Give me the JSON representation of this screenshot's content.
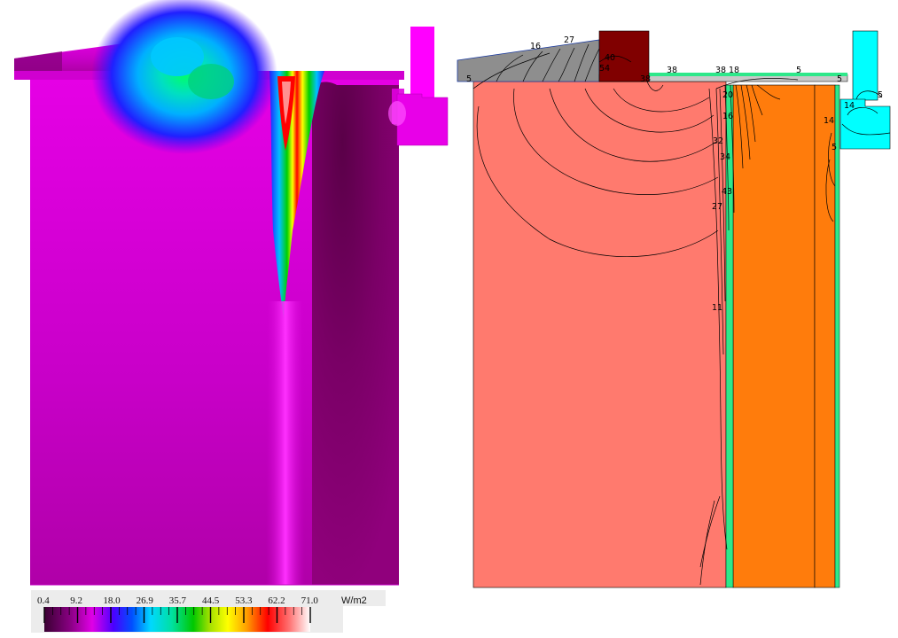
{
  "legend": {
    "tick_labels": [
      "0.4",
      "9.2",
      "18.0",
      "26.9",
      "35.7",
      "44.5",
      "53.3",
      "62.2",
      "71.0"
    ],
    "unit": "W/m2",
    "gradient_stops": [
      {
        "at": 0.0,
        "color": "#3a0032"
      },
      {
        "at": 0.1,
        "color": "#8b0085"
      },
      {
        "at": 0.18,
        "color": "#e000e6"
      },
      {
        "at": 0.26,
        "color": "#4a00ff"
      },
      {
        "at": 0.33,
        "color": "#0050ff"
      },
      {
        "at": 0.4,
        "color": "#00d8ff"
      },
      {
        "at": 0.48,
        "color": "#00e0a0"
      },
      {
        "at": 0.56,
        "color": "#00c800"
      },
      {
        "at": 0.62,
        "color": "#a0e000"
      },
      {
        "at": 0.69,
        "color": "#ffff00"
      },
      {
        "at": 0.76,
        "color": "#ffa000"
      },
      {
        "at": 0.84,
        "color": "#ff0000"
      },
      {
        "at": 0.92,
        "color": "#ff7070"
      },
      {
        "at": 1.0,
        "color": "#ffffff"
      }
    ]
  },
  "contour_labels": [
    "16",
    "27",
    "5",
    "40",
    "54",
    "38",
    "38",
    "38",
    "18",
    "5",
    "5",
    "5",
    "14",
    "14",
    "5",
    "20",
    "16",
    "32",
    "34",
    "43",
    "27",
    "11"
  ],
  "colors": {
    "flux_background": "#cf00cf",
    "dark_region": "#780060",
    "model_main": "#ff7a6e",
    "model_insulation": "#ff7c0c",
    "model_stud": "#2ee88a",
    "model_roof": "#8e8e8e",
    "model_slab": "#c8c8c8",
    "model_wall_cap": "#800000",
    "model_right_block": "#00ffff",
    "legend_panel": "#ececec"
  }
}
